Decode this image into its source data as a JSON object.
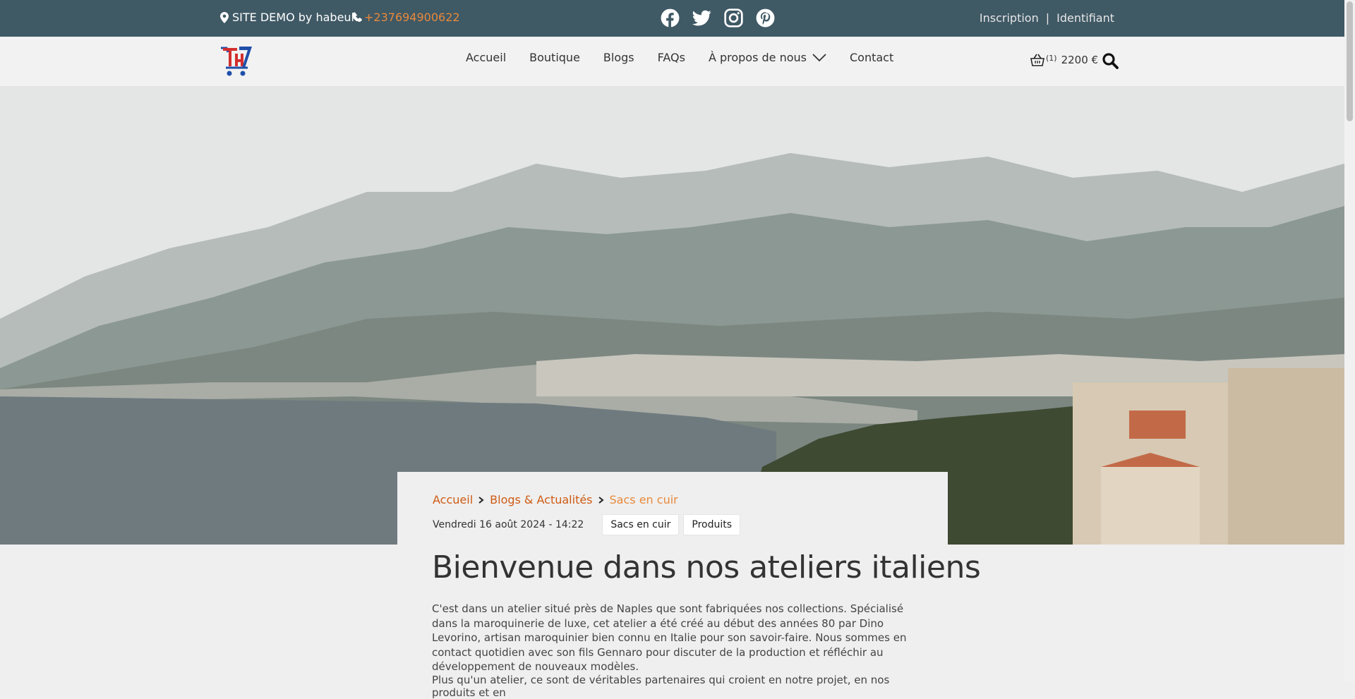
{
  "topbar": {
    "site_label": "SITE  DEMO by habeuk.",
    "phone": "+237694900622",
    "socials": [
      "facebook-icon",
      "twitter-icon",
      "instagram-icon",
      "pinterest-icon"
    ],
    "register": "Inscription",
    "separator": "|",
    "login": "Identifiant"
  },
  "nav": {
    "items": [
      "Accueil",
      "Boutique",
      "Blogs",
      "FAQs",
      "À propos de nous",
      "Contact"
    ],
    "cart_count": "(1)",
    "cart_total": "2200 €"
  },
  "breadcrumb": {
    "home": "Accueil",
    "section": "Blogs & Actualités",
    "current": "Sacs en cuir"
  },
  "meta": {
    "date": "Vendredi 16 août 2024 - 14:22",
    "tags": [
      "Sacs en cuir",
      "Produits"
    ]
  },
  "article": {
    "title": "Bienvenue dans nos ateliers italiens",
    "paragraph": "C'est dans un atelier situé près de  Naples que sont fabriquées nos collections. Spécialisé dans la maroquinerie de luxe, cet atelier a été créé au début des années 80 par  Dino  Levorino, artisan maroquinier bien connu en  Italie pour son savoir-faire.  Nous sommes en contact quotidien avec son fils Gennaro pour discuter de la production et réfléchir au développement de nouveaux modèles.",
    "paragraph_partial": "Plus qu'un atelier, ce sont de véritables partenaires qui croient en notre projet, en nos produits et en"
  },
  "colors": {
    "topbar_bg": "#3f5965",
    "accent": "#e8893b",
    "link": "#cf5a12"
  }
}
